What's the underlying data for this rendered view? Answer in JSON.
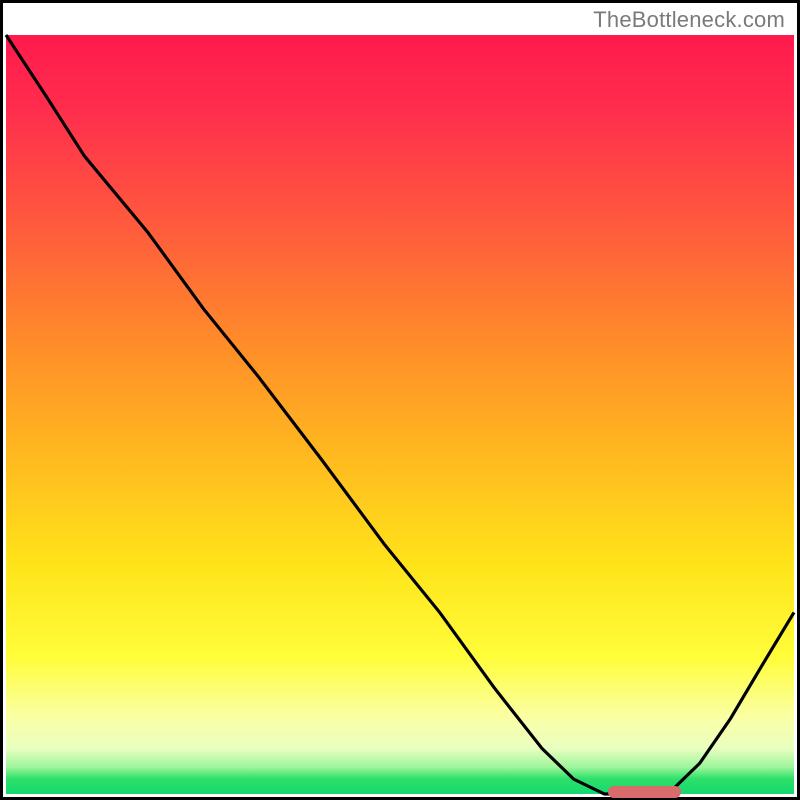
{
  "watermark": "TheBottleneck.com",
  "chart_data": {
    "type": "line",
    "title": "",
    "xlabel": "",
    "ylabel": "",
    "x": [
      0.0,
      0.05,
      0.1,
      0.18,
      0.25,
      0.32,
      0.4,
      0.48,
      0.55,
      0.62,
      0.68,
      0.72,
      0.76,
      0.8,
      0.84,
      0.88,
      0.92,
      0.96,
      1.0
    ],
    "y": [
      1.0,
      0.92,
      0.84,
      0.74,
      0.64,
      0.55,
      0.44,
      0.33,
      0.24,
      0.14,
      0.06,
      0.02,
      0.0,
      0.0,
      0.0,
      0.04,
      0.1,
      0.17,
      0.24
    ],
    "xlim": [
      0,
      1
    ],
    "ylim": [
      0,
      1
    ],
    "marker": {
      "x_start": 0.76,
      "x_end": 0.85,
      "y": 0.0
    },
    "background_gradient": [
      "#ff1a4d",
      "#ff8a2a",
      "#ffe41a",
      "#14d86e"
    ]
  }
}
